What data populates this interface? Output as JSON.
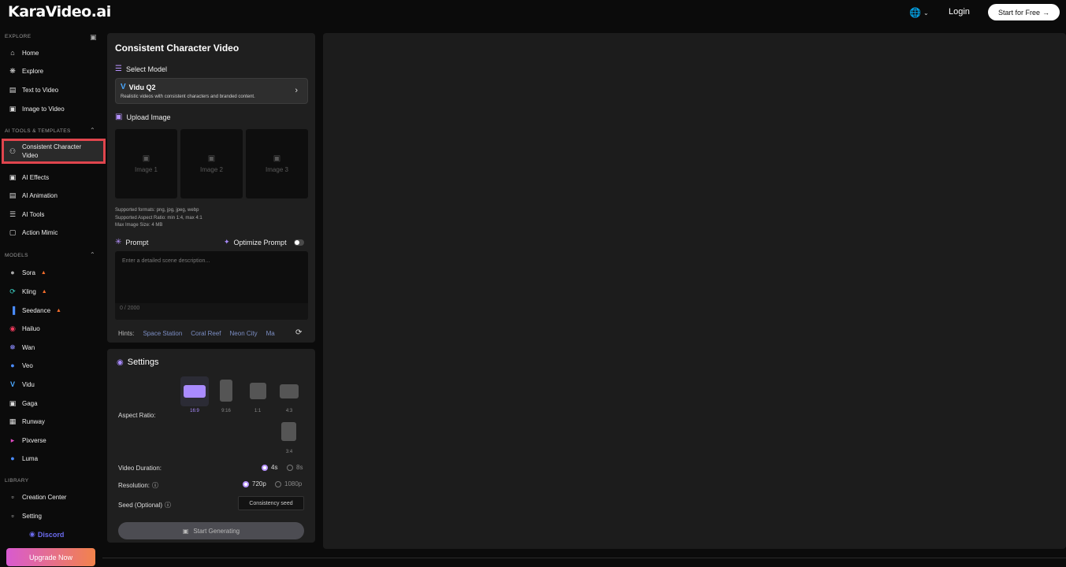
{
  "header": {
    "logo": "KaraVideo.ai",
    "language_icon": "globe-icon",
    "login": "Login",
    "start_free": "Start for Free",
    "start_free_icon": "arrow-right-icon"
  },
  "sidebar": {
    "explore_label": "EXPLORE",
    "explore_items": [
      {
        "label": "Home",
        "icon": "home-icon"
      },
      {
        "label": "Explore",
        "icon": "explore-icon"
      },
      {
        "label": "Text to Video",
        "icon": "text-icon"
      },
      {
        "label": "Image to Video",
        "icon": "image-icon"
      }
    ],
    "tools_label": "AI TOOLS & TEMPLATES",
    "tools_items": [
      {
        "label": "Consistent Character Video",
        "icon": "character-icon",
        "active": true
      },
      {
        "label": "AI Effects",
        "icon": "effects-icon"
      },
      {
        "label": "AI Animation",
        "icon": "animation-icon"
      },
      {
        "label": "AI Tools",
        "icon": "tools-icon"
      },
      {
        "label": "Action Mimic",
        "icon": "mimic-icon"
      }
    ],
    "models_label": "MODELS",
    "models": [
      {
        "label": "Sora",
        "hot": true
      },
      {
        "label": "Kling",
        "hot": true
      },
      {
        "label": "Seedance",
        "hot": true
      },
      {
        "label": "Hailuo"
      },
      {
        "label": "Wan"
      },
      {
        "label": "Veo"
      },
      {
        "label": "Vidu"
      },
      {
        "label": "Gaga"
      },
      {
        "label": "Runway"
      },
      {
        "label": "Pixverse"
      },
      {
        "label": "Luma"
      }
    ],
    "library_label": "LIBRARY",
    "library_items": [
      {
        "label": "Creation Center",
        "icon": "folder-icon"
      },
      {
        "label": "Setting",
        "icon": "folder-icon"
      }
    ],
    "discord": "Discord",
    "upgrade": "Upgrade Now"
  },
  "main": {
    "title": "Consistent Character Video",
    "select_model_label": "Select Model",
    "model": {
      "name": "Vidu Q2",
      "description": "Realistic videos with consistent characters and branded content."
    },
    "upload_label": "Upload Image",
    "images": [
      "Image 1",
      "Image 2",
      "Image 3"
    ],
    "formats": [
      "Supported formats: png, jpg, jpeg, webp",
      "Supported Aspect Ratio: min 1:4, max 4:1",
      "Max Image Size: 4 MB"
    ],
    "prompt_label": "Prompt",
    "optimize_label": "Optimize Prompt",
    "prompt_placeholder": "Enter a detailed scene description...",
    "prompt_count": "0 / 2000",
    "hints_label": "Hints:",
    "hints": [
      "Space Station",
      "Coral Reef",
      "Neon City",
      "Ma"
    ]
  },
  "settings": {
    "title": "Settings",
    "aspect_label": "Aspect Ratio:",
    "aspect_options": [
      "16:9",
      "9:16",
      "1:1",
      "4:3",
      "3:4"
    ],
    "aspect_selected": "16:9",
    "duration_label": "Video Duration:",
    "duration_options": [
      "4s",
      "8s"
    ],
    "duration_selected": "4s",
    "resolution_label": "Resolution:",
    "resolution_options": [
      "720p",
      "1080p"
    ],
    "resolution_selected": "720p",
    "seed_label": "Seed (Optional)",
    "seed_placeholder": "Consistency seed",
    "generate_label": "Start Generating"
  },
  "colors": {
    "accent": "#a98bff",
    "active_outline": "#e0454d",
    "upgrade_start": "#d85ad0",
    "upgrade_end": "#f2834b"
  }
}
